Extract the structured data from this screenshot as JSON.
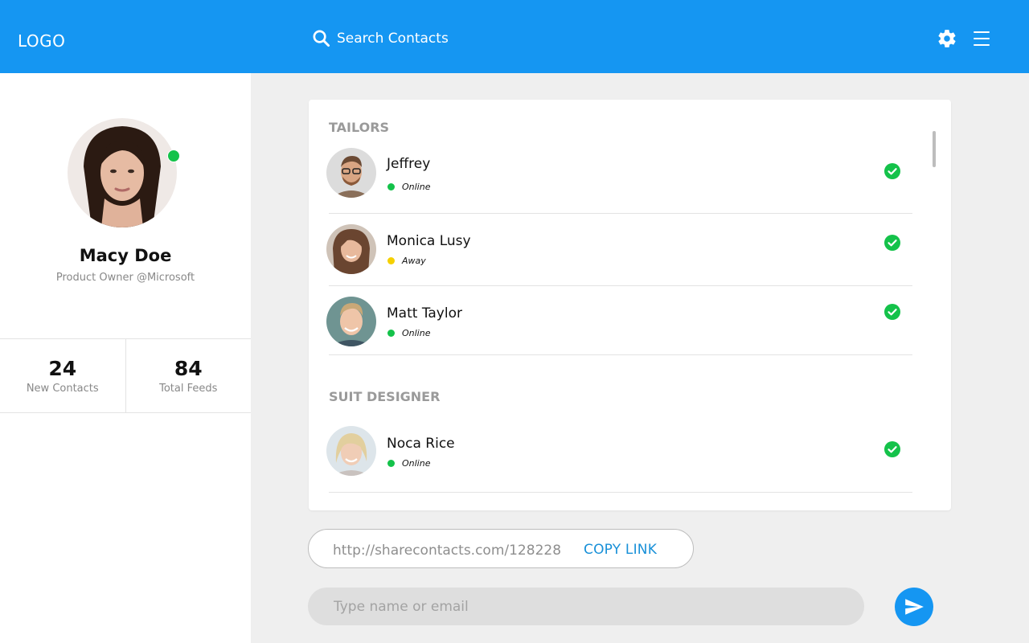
{
  "header": {
    "logo": "LOGO",
    "search_placeholder": "Search Contacts"
  },
  "profile": {
    "name": "Macy Doe",
    "role": "Product Owner @Microsoft",
    "status": "online",
    "stats": [
      {
        "value": "24",
        "label": "New Contacts"
      },
      {
        "value": "84",
        "label": "Total Feeds"
      }
    ]
  },
  "groups": [
    {
      "title": "TAILORS",
      "contacts": [
        {
          "name": "Jeffrey",
          "status": "Online"
        },
        {
          "name": "Monica Lusy",
          "status": "Away"
        },
        {
          "name": "Matt Taylor",
          "status": "Online"
        }
      ]
    },
    {
      "title": "SUIT DESIGNER",
      "contacts": [
        {
          "name": "Noca Rice",
          "status": "Online"
        }
      ]
    }
  ],
  "share": {
    "link": "http://sharecontacts.com/128228",
    "copy_label": "COPY LINK"
  },
  "invite": {
    "placeholder": "Type name or email"
  },
  "colors": {
    "primary": "#1596f2",
    "online": "#14c24a",
    "away": "#f5d000",
    "link": "#1890d8"
  },
  "icons": {
    "search": "search-icon",
    "settings": "gear-icon",
    "menu": "hamburger-menu-icon",
    "verified": "check-circle-icon",
    "send": "send-icon"
  }
}
